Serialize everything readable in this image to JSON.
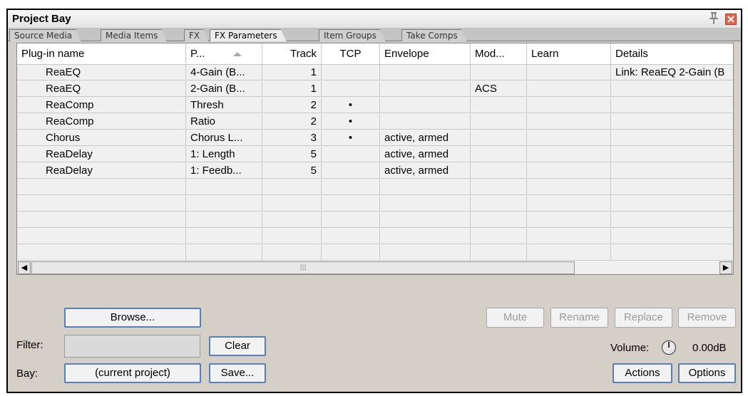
{
  "window": {
    "title": "Project Bay"
  },
  "tabs": [
    {
      "label": "Source Media"
    },
    {
      "label": "Media Items"
    },
    {
      "label": "FX"
    },
    {
      "label": "FX Parameters"
    },
    {
      "label": "Item Groups"
    },
    {
      "label": "Take Comps"
    }
  ],
  "active_tab": "FX Parameters",
  "columns": [
    "Plug-in name",
    "P...",
    "Track",
    "TCP",
    "Envelope",
    "Mod...",
    "Learn",
    "Details"
  ],
  "rows": [
    {
      "plugin": "ReaEQ",
      "param": "4-Gain (B...",
      "track": "1",
      "tcp": "",
      "envelope": "",
      "mod": "",
      "learn": "",
      "details": "Link: ReaEQ  2-Gain (B"
    },
    {
      "plugin": "ReaEQ",
      "param": "2-Gain (B...",
      "track": "1",
      "tcp": "",
      "envelope": "",
      "mod": "ACS",
      "learn": "",
      "details": ""
    },
    {
      "plugin": "ReaComp",
      "param": "Thresh",
      "track": "2",
      "tcp": "•",
      "envelope": "",
      "mod": "",
      "learn": "",
      "details": ""
    },
    {
      "plugin": "ReaComp",
      "param": "Ratio",
      "track": "2",
      "tcp": "•",
      "envelope": "",
      "mod": "",
      "learn": "",
      "details": ""
    },
    {
      "plugin": "Chorus",
      "param": "Chorus L...",
      "track": "3",
      "tcp": "•",
      "envelope": "active, armed",
      "mod": "",
      "learn": "",
      "details": ""
    },
    {
      "plugin": "ReaDelay",
      "param": "1: Length",
      "track": "5",
      "tcp": "",
      "envelope": "active, armed",
      "mod": "",
      "learn": "",
      "details": ""
    },
    {
      "plugin": "ReaDelay",
      "param": "1: Feedb...",
      "track": "5",
      "tcp": "",
      "envelope": "active, armed",
      "mod": "",
      "learn": "",
      "details": ""
    }
  ],
  "buttons": {
    "browse": "Browse...",
    "clear": "Clear",
    "bay_value": "(current project)",
    "save": "Save...",
    "mute": "Mute",
    "rename": "Rename",
    "replace": "Replace",
    "remove": "Remove",
    "actions": "Actions",
    "options": "Options"
  },
  "labels": {
    "filter": "Filter:",
    "bay": "Bay:",
    "volume": "Volume:",
    "volume_value": "0.00dB"
  },
  "scrollbar": {
    "thumb_grip": "|||"
  }
}
